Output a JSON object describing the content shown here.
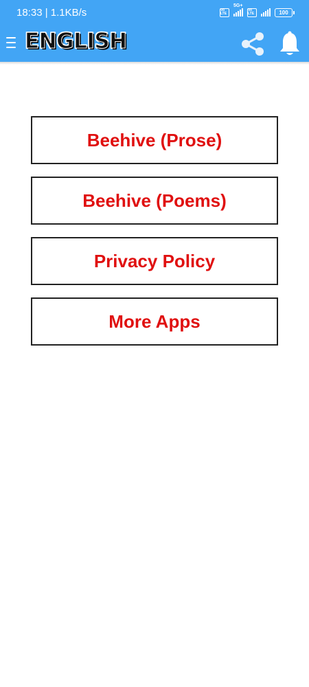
{
  "status_bar": {
    "time_speed": "18:33 | 1.1KB/s",
    "volte_label_1": "Vo LTE",
    "network_type": "5G+",
    "volte_label_2": "Vo LTE",
    "battery": "100"
  },
  "app_bar": {
    "title": "ENGLISH",
    "menu_icon": "hamburger-menu-icon",
    "share_icon": "share-icon",
    "notification_icon": "bell-icon"
  },
  "menu": {
    "items": [
      {
        "label": "Beehive (Prose)"
      },
      {
        "label": "Beehive (Poems)"
      },
      {
        "label": "Privacy Policy"
      },
      {
        "label": "More Apps"
      }
    ]
  },
  "colors": {
    "app_bar": "#42a5f5",
    "button_text": "#e01010",
    "button_border": "#222222",
    "background": "#ffffff"
  }
}
